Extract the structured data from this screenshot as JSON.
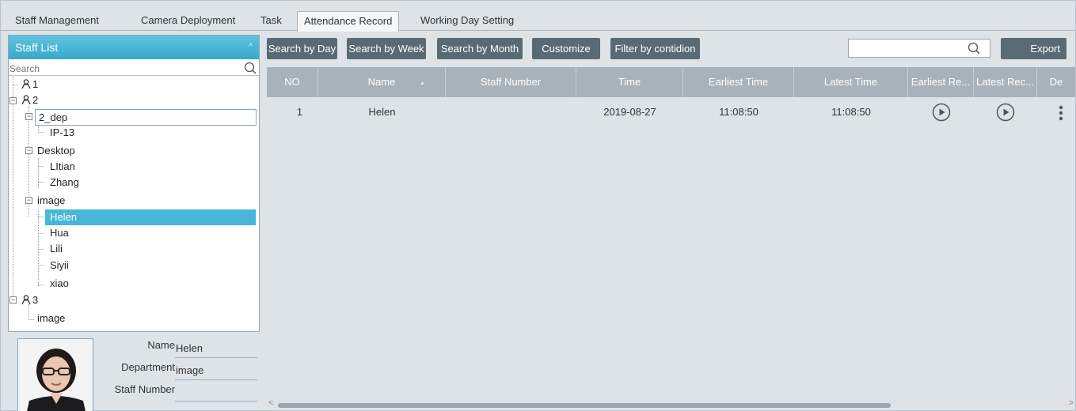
{
  "tabs": [
    {
      "label": "Staff Management"
    },
    {
      "label": "Camera Deployment"
    },
    {
      "label": "Task"
    },
    {
      "label": "Attendance Record"
    },
    {
      "label": "Working Day Setting"
    }
  ],
  "active_tab": "Attendance Record",
  "staff_list": {
    "title": "Staff List",
    "search_placeholder": "Search",
    "tree": {
      "g1": "1",
      "g2": "2",
      "g2_dep": "2_dep",
      "ip13": "IP-13",
      "desktop": "Desktop",
      "ltian": "LItian",
      "zhang": "Zhang",
      "image": "image",
      "helen": "Helen",
      "hua": "Hua",
      "lili": "Lili",
      "siyii": "Siyii",
      "xiao": "xiao",
      "g3": "3",
      "image3": "image"
    }
  },
  "profile": {
    "name_label": "Name",
    "name_value": "Helen",
    "department_label": "Department",
    "department_value": "image",
    "staff_number_label": "Staff Number",
    "staff_number_value": ""
  },
  "toolbar": {
    "search_by_day": "Search by Day",
    "search_by_week": "Search by Week",
    "search_by_month": "Search by Month",
    "customize": "Customize",
    "filter": "Filter by contidion",
    "search_value": "",
    "export": "Export"
  },
  "table": {
    "columns": [
      "NO",
      "Name",
      "Staff Number",
      "Time",
      "Earliest Time",
      "Latest Time",
      "Earliest Re...",
      "Latest Rec...",
      "De"
    ],
    "rows": [
      {
        "no": "1",
        "name": "Helen",
        "staff_number": "",
        "time": "2019-08-27",
        "earliest_time": "11:08:50",
        "latest_time": "11:08:50"
      }
    ]
  },
  "colors": {
    "accent": "#47b6d8",
    "button": "#5a6a74",
    "header": "#a8b2ba",
    "background": "#dde3e7"
  }
}
